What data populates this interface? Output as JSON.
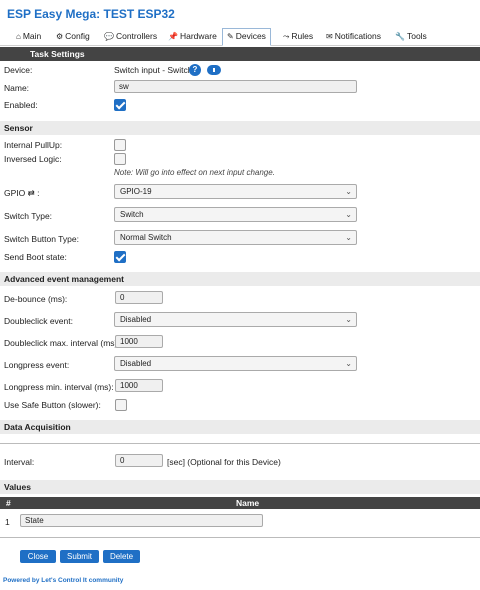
{
  "app": {
    "title": "ESP Easy Mega: TEST ESP32"
  },
  "tabs": [
    {
      "label": "Main",
      "icon": "⌂"
    },
    {
      "label": "Config",
      "icon": "⚙"
    },
    {
      "label": "Controllers",
      "icon": "💬"
    },
    {
      "label": "Hardware",
      "icon": "📌"
    },
    {
      "label": "Devices",
      "icon": "✎"
    },
    {
      "label": "Rules",
      "icon": "⤳"
    },
    {
      "label": "Notifications",
      "icon": "✉"
    },
    {
      "label": "Tools",
      "icon": "🔧"
    }
  ],
  "task_settings": {
    "header": "Task Settings",
    "device_label": "Device:",
    "device_value": "Switch input - Switch",
    "help_icon": "?",
    "name_label": "Name:",
    "name_value": "sw",
    "enabled_label": "Enabled:",
    "enabled": true
  },
  "sensor": {
    "header": "Sensor",
    "pullup_label": "Internal PullUp:",
    "pullup": false,
    "inversed_label": "Inversed Logic:",
    "inversed": false,
    "note": "Note: Will go into effect on next input change.",
    "gpio_label": "GPIO ⇄ :",
    "gpio_value": "GPIO-19",
    "switch_type_label": "Switch Type:",
    "switch_type_value": "Switch",
    "switch_button_type_label": "Switch Button Type:",
    "switch_button_type_value": "Normal Switch",
    "send_boot_label": "Send Boot state:",
    "send_boot": true
  },
  "advanced": {
    "header": "Advanced event management",
    "debounce_label": "De-bounce (ms):",
    "debounce_value": "0",
    "doubleclick_label": "Doubleclick event:",
    "doubleclick_value": "Disabled",
    "doubleclick_interval_label": "Doubleclick max. interval (ms):",
    "doubleclick_interval_value": "1000",
    "longpress_label": "Longpress event:",
    "longpress_value": "Disabled",
    "longpress_interval_label": "Longpress min. interval (ms):",
    "longpress_interval_value": "1000",
    "safe_button_label": "Use Safe Button (slower):",
    "safe_button": false
  },
  "data_acquisition": {
    "header": "Data Acquisition",
    "interval_label": "Interval:",
    "interval_value": "0",
    "interval_suffix": "[sec] (Optional for this Device)"
  },
  "values": {
    "header": "Values",
    "col_num": "#",
    "col_name": "Name",
    "rows": [
      {
        "num": "1",
        "name": "State"
      }
    ]
  },
  "buttons": {
    "close": "Close",
    "submit": "Submit",
    "delete": "Delete"
  },
  "footer": {
    "prefix": "Powered by ",
    "brand": "Let's Control It",
    "suffix": " community"
  },
  "colors": {
    "accent": "#1f6fc5",
    "section_bg": "#ebebeb",
    "dark_header": "#444444"
  }
}
